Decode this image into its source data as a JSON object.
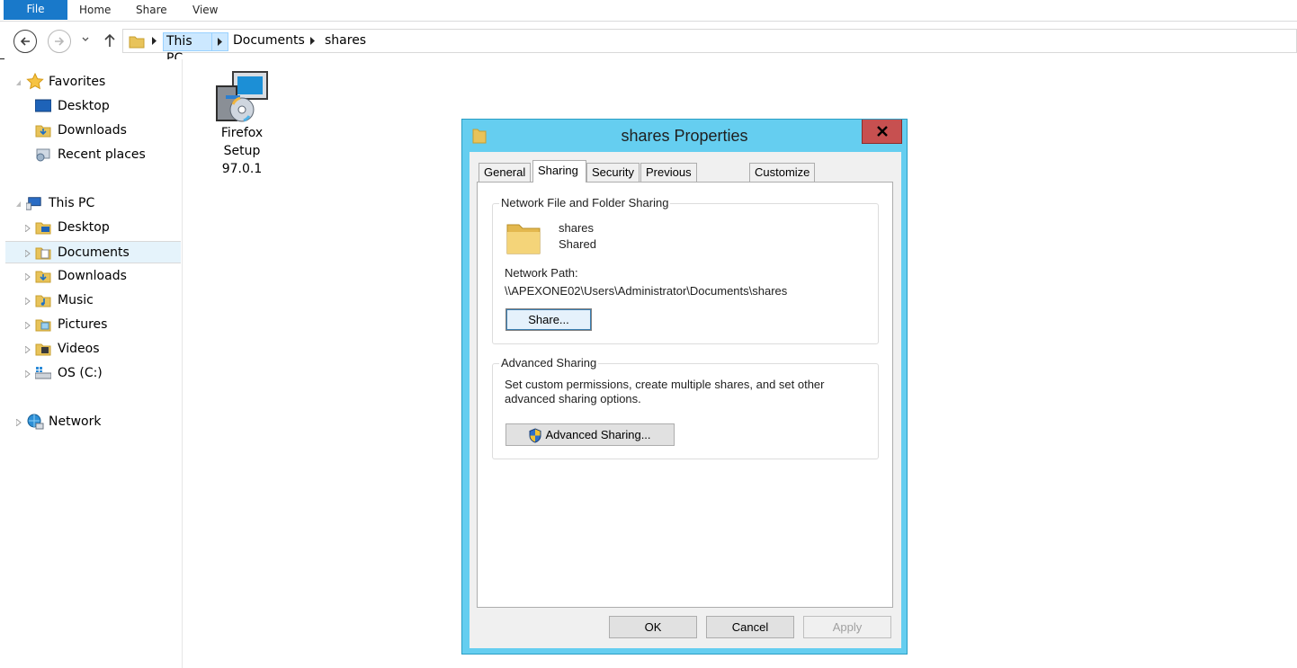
{
  "ribbon": {
    "tabs": [
      "File",
      "Home",
      "Share",
      "View"
    ]
  },
  "address": {
    "crumbs": [
      "This PC",
      "Documents",
      "shares"
    ]
  },
  "navpane": {
    "favorites": {
      "label": "Favorites",
      "items": [
        "Desktop",
        "Downloads",
        "Recent places"
      ]
    },
    "thispc": {
      "label": "This PC",
      "items": [
        "Desktop",
        "Documents",
        "Downloads",
        "Music",
        "Pictures",
        "Videos",
        "OS (C:)"
      ]
    },
    "network": {
      "label": "Network"
    }
  },
  "content": {
    "files": [
      {
        "name": "Firefox\nSetup\n97.0.1",
        "icon": "installer-icon"
      }
    ]
  },
  "dialog": {
    "title": "shares Properties",
    "tabs": [
      "General",
      "Sharing",
      "Security",
      "Previous Versions",
      "Customize"
    ],
    "active_tab": "Sharing",
    "network_group": {
      "legend": "Network File and Folder Sharing",
      "folder_name": "shares",
      "folder_state": "Shared",
      "path_label": "Network Path:",
      "path_value": "\\\\APEXONE02\\Users\\Administrator\\Documents\\shares",
      "share_button": "Share..."
    },
    "advanced_group": {
      "legend": "Advanced Sharing",
      "description_line1": "Set custom permissions, create multiple shares, and set other",
      "description_line2": "advanced sharing options.",
      "advanced_button": "Advanced Sharing..."
    },
    "buttons": {
      "ok": "OK",
      "cancel": "Cancel",
      "apply": "Apply"
    }
  },
  "colors": {
    "file_tab": "#1979ca",
    "dialog_frame": "#65cef0",
    "close_button": "#c75050",
    "selection": "#cce8ff"
  }
}
